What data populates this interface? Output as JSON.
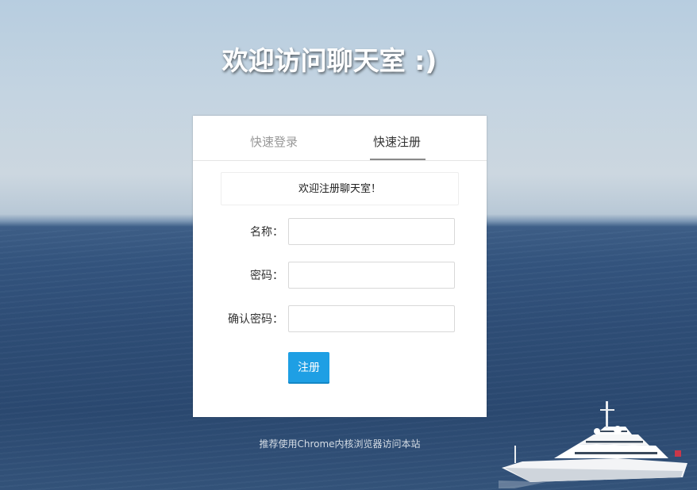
{
  "page": {
    "headline": "欢迎访问聊天室 :)",
    "footer_note": "推荐使用Chrome内核浏览器访问本站"
  },
  "tabs": [
    {
      "label": "快速登录",
      "active": false
    },
    {
      "label": "快速注册",
      "active": true
    }
  ],
  "register": {
    "notice": "欢迎注册聊天室！",
    "name_label": "名称：",
    "name_value": "",
    "password_label": "密码：",
    "password_value": "",
    "confirm_label": "确认密码：",
    "confirm_value": "",
    "submit_label": "注册"
  },
  "colors": {
    "primary_button": "#1e9fe4",
    "panel_background": "#ffffff",
    "active_tab_text": "#333333",
    "inactive_tab_text": "#999999"
  },
  "background": {
    "scene": "sea-with-yacht"
  }
}
